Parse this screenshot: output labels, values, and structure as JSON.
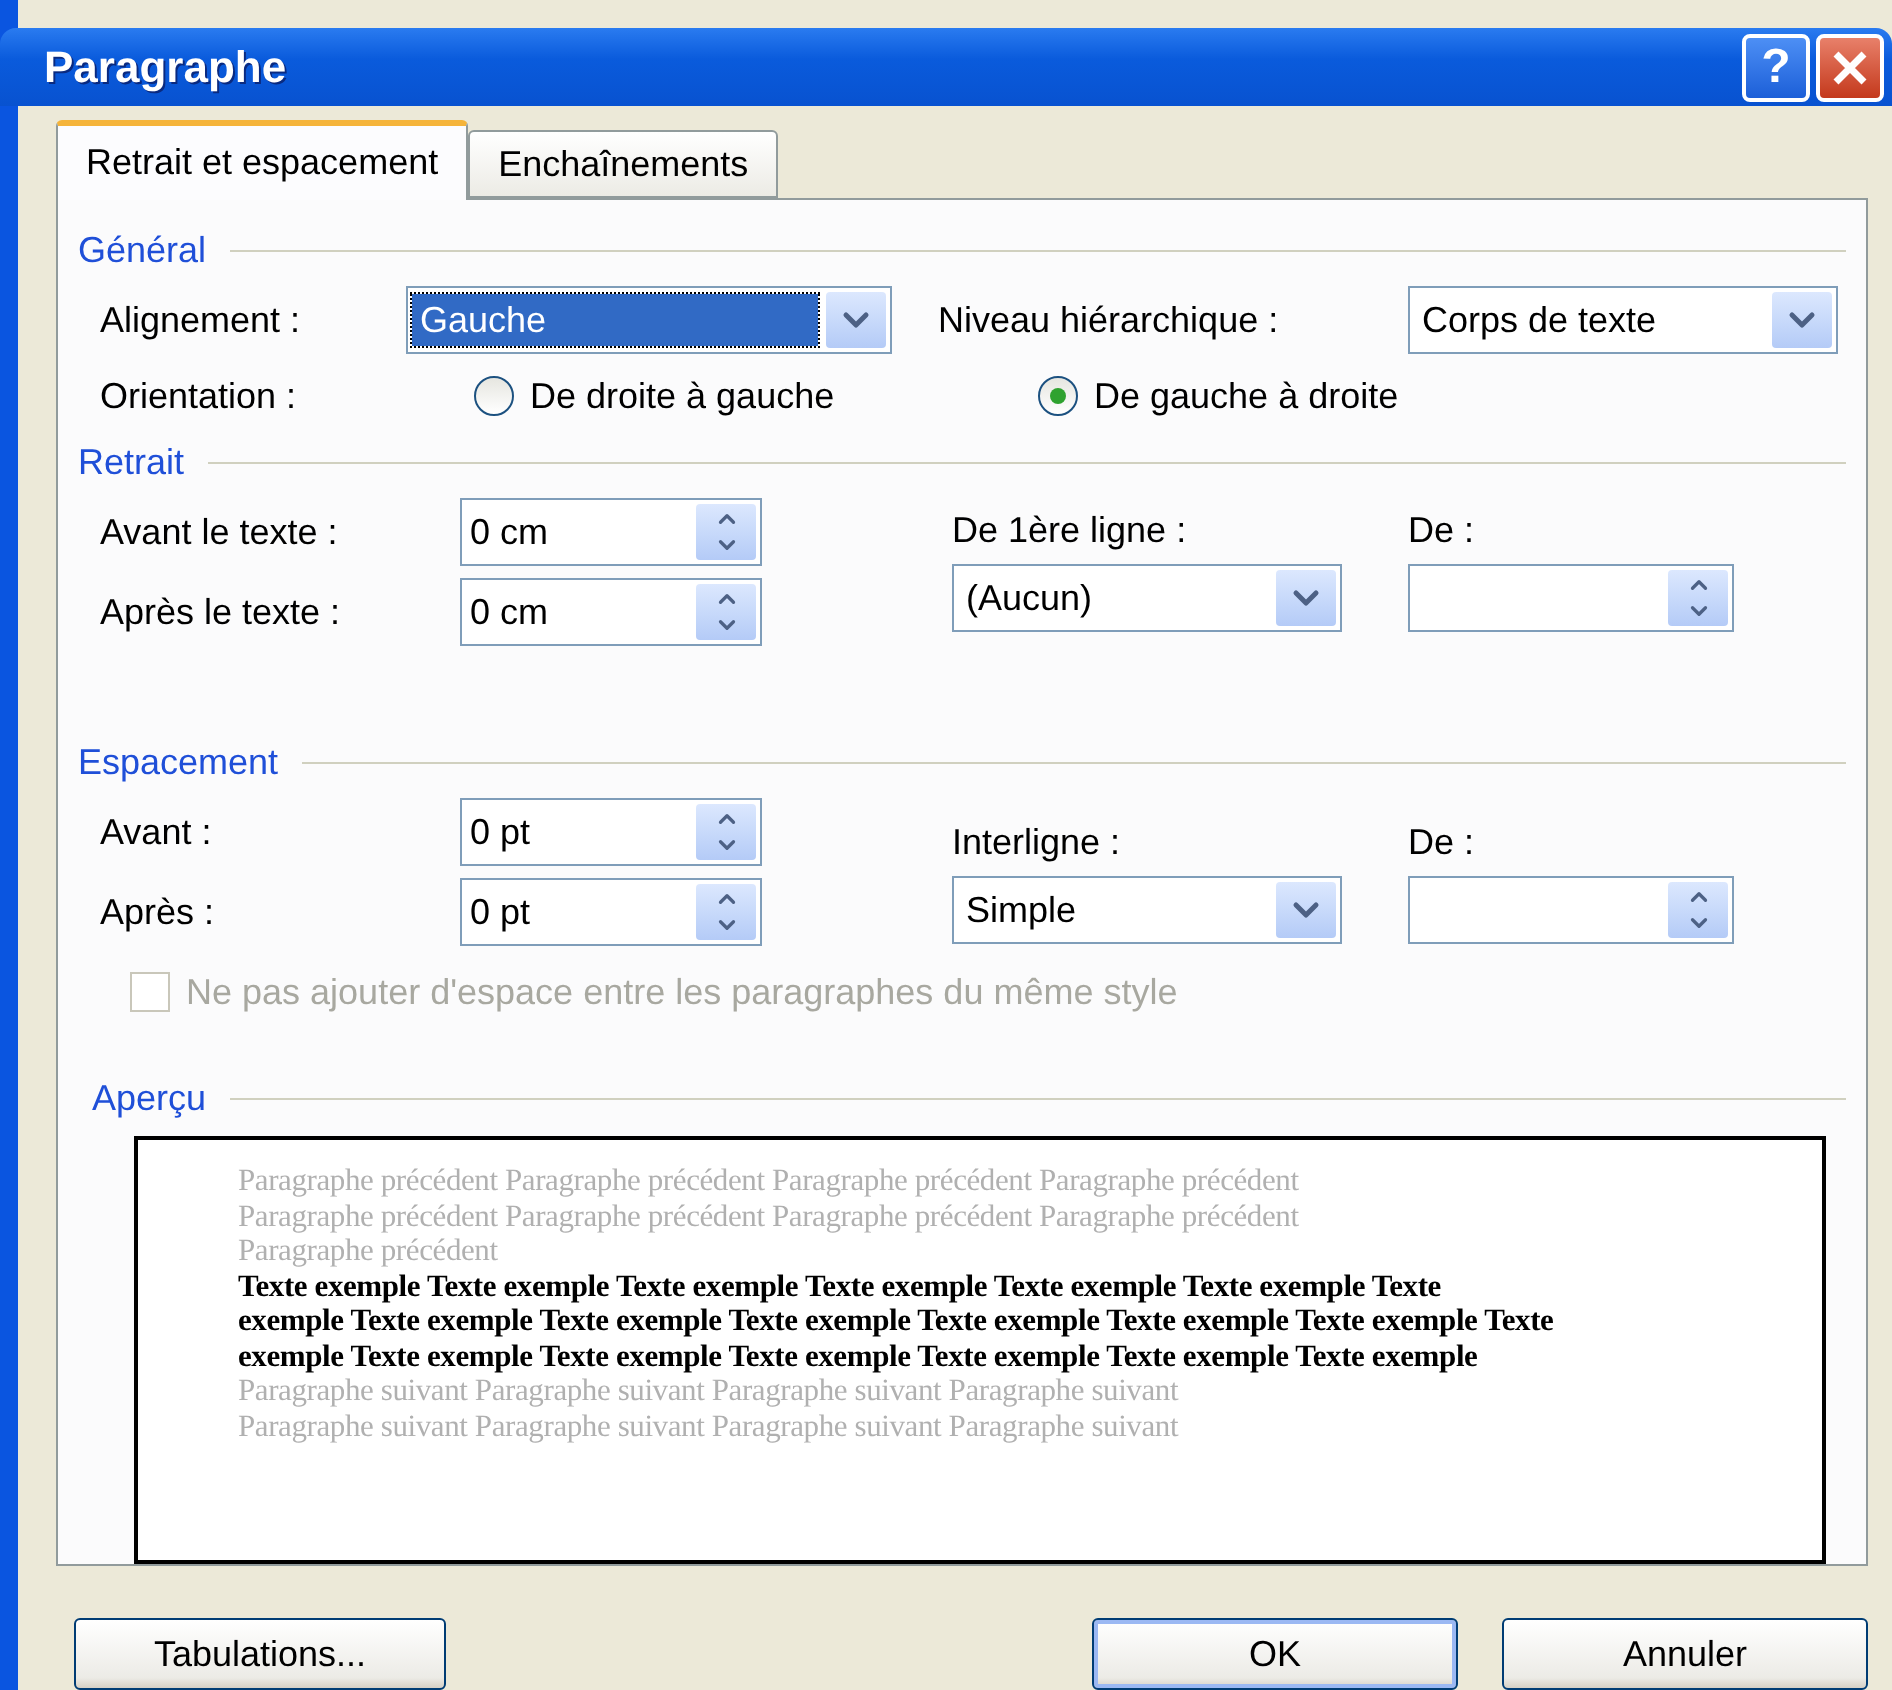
{
  "window": {
    "title": "Paragraphe"
  },
  "title_buttons": [
    {
      "kind": "help",
      "label": "?"
    },
    {
      "kind": "close"
    }
  ],
  "tabs": [
    {
      "label": "Retrait et espacement",
      "selected": true
    },
    {
      "label": "Enchaînements",
      "selected": false
    }
  ],
  "general": {
    "heading": "Général",
    "alignment": {
      "label": "Alignement :",
      "value": "Gauche",
      "focused": true
    },
    "outline_level": {
      "label": "Niveau hiérarchique :",
      "value": "Corps de texte",
      "focused": false
    },
    "orientation": {
      "label": "Orientation :",
      "options": [
        {
          "label": "De droite à gauche",
          "selected": false
        },
        {
          "label": "De gauche à droite",
          "selected": true
        }
      ]
    }
  },
  "indentation": {
    "heading": "Retrait",
    "before": {
      "label": "Avant le texte :",
      "value": "0 cm"
    },
    "after": {
      "label": "Après le texte :",
      "value": "0 cm"
    },
    "first_line": {
      "label": "De 1ère ligne :",
      "value": "(Aucun)"
    },
    "by": {
      "label": "De :"
    }
  },
  "spacing": {
    "heading": "Espacement",
    "before": {
      "label": "Avant :",
      "value": "0 pt"
    },
    "after": {
      "label": "Après :",
      "value": "0 pt"
    },
    "line_spacing": {
      "label": "Interligne :",
      "value": "Simple"
    },
    "at": {
      "label": "De :"
    }
  },
  "dont_add_space": {
    "label": "Ne pas ajouter d'espace entre les paragraphes du même style",
    "checked": false,
    "disabled": true
  },
  "preview": {
    "heading": "Aperçu",
    "previous_lines": [
      "Paragraphe précédent Paragraphe précédent Paragraphe précédent Paragraphe précédent",
      "Paragraphe précédent Paragraphe précédent Paragraphe précédent Paragraphe précédent",
      "Paragraphe précédent"
    ],
    "sample_lines": [
      "Texte exemple Texte exemple Texte exemple Texte exemple Texte exemple Texte exemple Texte",
      "exemple Texte exemple Texte exemple Texte exemple Texte exemple Texte exemple Texte exemple Texte",
      "exemple Texte exemple Texte exemple Texte exemple Texte exemple Texte exemple Texte exemple"
    ],
    "next_lines": [
      "Paragraphe suivant Paragraphe suivant Paragraphe suivant Paragraphe suivant",
      "Paragraphe suivant Paragraphe suivant Paragraphe suivant Paragraphe suivant"
    ]
  },
  "buttons": [
    {
      "label": "Tabulations...",
      "default": false
    },
    {
      "label": "OK",
      "default": true
    },
    {
      "label": "Annuler",
      "default": false
    }
  ]
}
